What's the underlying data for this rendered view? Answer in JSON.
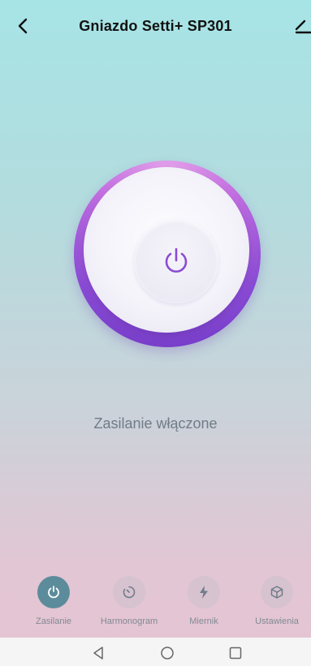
{
  "header": {
    "title": "Gniazdo Setti+ SP301",
    "back_icon": "chevron-left-icon",
    "edit_icon": "edit-icon"
  },
  "dial": {
    "power_icon": "power-icon",
    "state": "on",
    "accent_color": "#8a4bd4"
  },
  "status": {
    "text": "Zasilanie włączone"
  },
  "tabs": [
    {
      "label": "Zasilanie",
      "icon": "power-icon",
      "active": true
    },
    {
      "label": "Harmonogram",
      "icon": "timer-icon",
      "active": false
    },
    {
      "label": "Miernik",
      "icon": "lightning-icon",
      "active": false
    },
    {
      "label": "Ustawienia",
      "icon": "cube-icon",
      "active": false
    }
  ],
  "navbar": {
    "buttons": [
      "back-triangle-icon",
      "home-circle-icon",
      "recents-square-icon"
    ]
  }
}
